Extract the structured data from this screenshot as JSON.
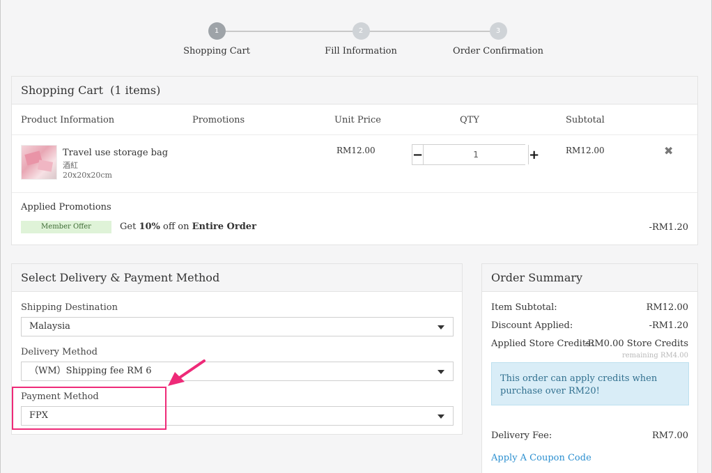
{
  "steps": [
    {
      "number": "1",
      "label": "Shopping Cart"
    },
    {
      "number": "2",
      "label": "Fill Information"
    },
    {
      "number": "3",
      "label": "Order Confirmation"
    }
  ],
  "cart": {
    "title": "Shopping Cart",
    "count": "(1 items)",
    "columns": {
      "product": "Product Information",
      "promotions": "Promotions",
      "unit_price": "Unit Price",
      "qty": "QTY",
      "subtotal": "Subtotal"
    },
    "item": {
      "name": "Travel use storage bag",
      "variant": "酒紅",
      "size": "20x20x20cm",
      "unit_price": "RM12.00",
      "qty": "1",
      "subtotal": "RM12.00",
      "minus": "−",
      "plus": "+",
      "remove": "✖"
    },
    "promotions": {
      "title": "Applied Promotions",
      "badge": "Member Offer",
      "desc_prefix": "Get",
      "desc_percent": "10%",
      "desc_mid": "off on",
      "desc_target": "Entire Order",
      "amount": "-RM1.20"
    }
  },
  "delivery": {
    "title": "Select Delivery & Payment Method",
    "shipping_label": "Shipping Destination",
    "shipping_value": "Malaysia",
    "delivery_label": "Delivery Method",
    "delivery_value": "（WM）Shipping fee RM 6",
    "payment_label": "Payment Method",
    "payment_value": "FPX"
  },
  "summary": {
    "title": "Order Summary",
    "item_subtotal_label": "Item Subtotal:",
    "item_subtotal_value": "RM12.00",
    "discount_label": "Discount Applied:",
    "discount_value": "-RM1.20",
    "credits_label": "Applied Store Credits:",
    "credits_value": "-RM0.00 Store Credits",
    "remaining": "remaining RM4.00",
    "credit_note": "This order can apply credits when purchase over RM20!",
    "delivery_fee_label": "Delivery Fee:",
    "delivery_fee_value": "RM7.00",
    "coupon_link": "Apply A Coupon Code"
  },
  "colors": {
    "highlight": "#ee2a78",
    "link": "#2b8fd0",
    "promo_badge_bg": "#dff3d8",
    "info_bg": "#d9edf7"
  }
}
